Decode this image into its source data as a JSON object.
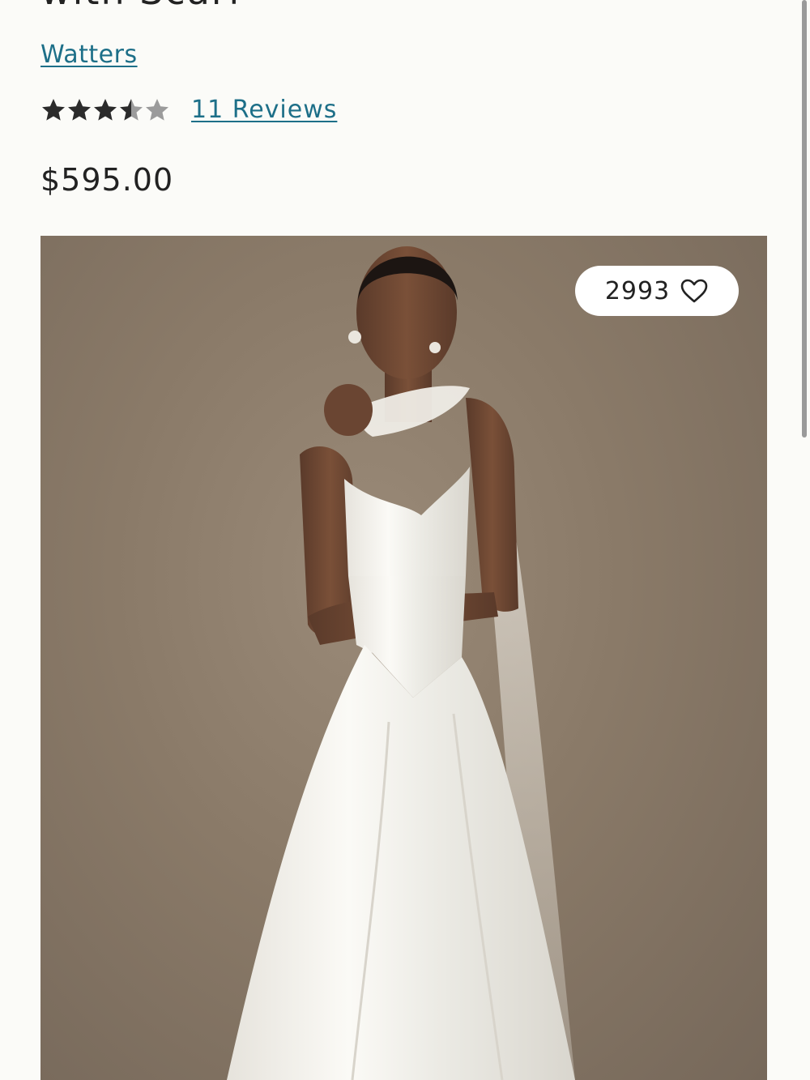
{
  "product": {
    "title_partial": "with Scarf",
    "brand": "Watters",
    "rating": {
      "value": 3.5,
      "max": 5
    },
    "reviews_label": "11 Reviews",
    "price": "$595.00"
  },
  "image": {
    "favorite_count": "2993",
    "favorite_icon": "heart-outline-icon"
  },
  "colors": {
    "link": "#1d6f88",
    "star_filled": "#2b2b2b",
    "star_empty": "#9b9b9b",
    "background": "#fbfbf8"
  }
}
